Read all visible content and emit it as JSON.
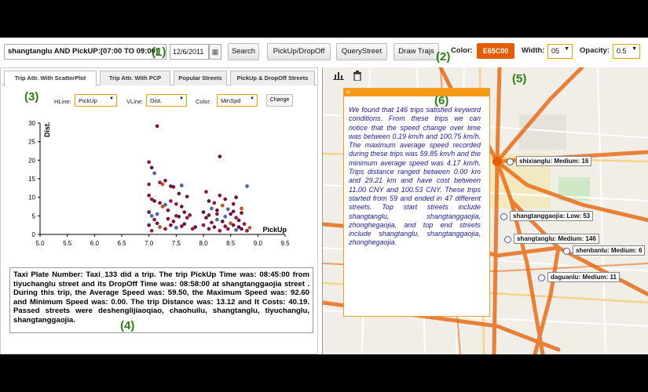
{
  "toolbar": {
    "query_value": "shangtanglu AND PickUP:[07:00 TO 09:00]",
    "date_value": "12/6/2011",
    "calendar_icon": "calendar-icon",
    "search_label": "Search",
    "pickup_dropoff_label": "PickUp/DropOff",
    "query_street_label": "QueryStreet",
    "draw_trajs_label": "Draw Trajs",
    "color_label": "Color:",
    "color_value": "E65C00",
    "color_hex": "#E65C00",
    "width_label": "Width:",
    "width_value": "05",
    "opacity_label": "Opacity:",
    "opacity_value": "0.5"
  },
  "annotations": [
    "(1)",
    "(2)",
    "(3)",
    "(4)",
    "(5)",
    "(6)"
  ],
  "tabs": [
    {
      "label": "Trip Attr. With ScatterPlot",
      "active": true
    },
    {
      "label": "Trip Attr. With PCP",
      "active": false
    },
    {
      "label": "Popular Streets",
      "active": false
    },
    {
      "label": "PickUp & DropOff Streets",
      "active": false
    }
  ],
  "controls": {
    "hline_label": "HLine:",
    "hline_value": "PickUp",
    "vline_label": "VLine:",
    "vline_value": "Dist.",
    "color_label": "Color:",
    "color_value": "MinSpd",
    "change_label": "Change"
  },
  "chart_data": {
    "type": "scatter",
    "xlabel": "PickUp",
    "ylabel": "Dist.",
    "xlim": [
      5.0,
      9.5
    ],
    "ylim": [
      0,
      30
    ],
    "xticks": [
      "5.0",
      "5.5",
      "6.0",
      "6.5",
      "7.0",
      "7.5",
      "8.0",
      "8.5",
      "9.0",
      "9.5"
    ],
    "yticks": [
      "0",
      "5",
      "10",
      "15",
      "20",
      "25",
      "30"
    ],
    "points": [
      [
        7.15,
        29.2
      ],
      [
        7.0,
        19.5
      ],
      [
        7.05,
        18.0
      ],
      [
        7.1,
        16.5
      ],
      [
        7.2,
        14.0
      ],
      [
        7.25,
        13.5
      ],
      [
        7.3,
        14.5
      ],
      [
        7.0,
        13.5
      ],
      [
        7.4,
        13.0
      ],
      [
        7.45,
        12.8
      ],
      [
        7.6,
        13.2
      ],
      [
        7.55,
        11.0
      ],
      [
        7.0,
        10.5
      ],
      [
        7.05,
        9.5
      ],
      [
        7.1,
        9.0
      ],
      [
        7.2,
        8.5
      ],
      [
        7.25,
        7.5
      ],
      [
        7.3,
        8.0
      ],
      [
        7.35,
        6.5
      ],
      [
        7.5,
        8.2
      ],
      [
        7.6,
        7.5
      ],
      [
        7.65,
        6.0
      ],
      [
        7.7,
        4.5
      ],
      [
        7.0,
        6.0
      ],
      [
        7.05,
        5.0
      ],
      [
        7.1,
        4.0
      ],
      [
        7.15,
        3.0
      ],
      [
        7.2,
        2.0
      ],
      [
        7.3,
        1.5
      ],
      [
        7.4,
        2.5
      ],
      [
        7.45,
        3.5
      ],
      [
        7.5,
        1.8
      ],
      [
        7.55,
        4.8
      ],
      [
        7.6,
        2.2
      ],
      [
        7.8,
        1.5
      ],
      [
        7.85,
        2.0
      ],
      [
        7.0,
        2.5
      ],
      [
        7.05,
        1.0
      ],
      [
        7.15,
        5.5
      ],
      [
        7.35,
        4.2
      ],
      [
        7.5,
        5.0
      ],
      [
        7.65,
        2.8
      ],
      [
        7.75,
        5.2
      ],
      [
        8.05,
        11.5
      ],
      [
        8.1,
        9.0
      ],
      [
        8.15,
        7.0
      ],
      [
        8.2,
        8.5
      ],
      [
        8.25,
        6.5
      ],
      [
        8.3,
        10.5
      ],
      [
        8.35,
        7.8
      ],
      [
        8.3,
        21.0
      ],
      [
        8.4,
        9.5
      ],
      [
        8.45,
        6.8
      ],
      [
        8.5,
        5.5
      ],
      [
        8.55,
        8.2
      ],
      [
        8.6,
        4.5
      ],
      [
        8.65,
        3.8
      ],
      [
        8.7,
        5.8
      ],
      [
        8.75,
        2.8
      ],
      [
        8.8,
        13.0
      ],
      [
        8.85,
        1.8
      ],
      [
        8.0,
        2.5
      ],
      [
        8.05,
        4.5
      ],
      [
        8.1,
        1.5
      ],
      [
        8.15,
        3.2
      ],
      [
        8.2,
        2.0
      ],
      [
        8.25,
        4.0
      ],
      [
        8.3,
        1.0
      ],
      [
        8.35,
        3.5
      ],
      [
        8.4,
        2.2
      ],
      [
        8.45,
        1.5
      ],
      [
        8.5,
        3.0
      ],
      [
        8.55,
        2.5
      ],
      [
        8.6,
        1.2
      ],
      [
        8.65,
        2.0
      ],
      [
        8.7,
        1.5
      ],
      [
        8.8,
        1.0
      ],
      [
        8.0,
        6.0
      ],
      [
        8.1,
        5.2
      ],
      [
        8.25,
        5.5
      ],
      [
        8.4,
        4.8
      ],
      [
        8.55,
        6.2
      ],
      [
        8.7,
        7.0
      ],
      [
        8.6,
        10.0
      ],
      [
        7.7,
        10.2
      ],
      [
        7.4,
        9.0
      ]
    ]
  },
  "trip_info": "Taxi Plate Number: Taxi_133 did a trip. The trip PickUp Time was: 08:45:00 from tiyuchanglu street and its DropOff Time was: 08:58:00 at shangtanggaojia street . During this trip, the Average Speed was: 59.50, the Maximum Speed was: 92.60 and Minimum Speed was: 0.00. The trip Distance was: 13.12 and It Costs: 40.19. Passed streets were deshenglijiaoqiao, chaohuilu, shangtanglu, tiyuchanglu, shangtanggaojia.",
  "map": {
    "chart_icon": "bar-chart-icon",
    "trash_icon": "trash-icon",
    "popup_text": "We found that 146 trips satisfied keyword conditions. From these trips we can notice that the speed change over time was between 0.19 km/h and 100.75 km/h. The maximum average speed recorded during these trips was 59.85 km/h and the minimum average speed was 4.17 km/h. Trips distance ranged between 0.00 km and 29.21 km and have cost between 11.00 CNY and 100.53 CNY. These trips started from 59 and ended in 47 different streets. Top start streets include shangtanglu, shangtanggaojia, zhonghegaojia, and top end streets include shangtanglu, shangtanggaojia, zhonghegaojia.",
    "streets": [
      {
        "label": "shixianglu: Medium: 16"
      },
      {
        "label": "shangtanggaojia: Low: 53"
      },
      {
        "label": "shangtanglu: Medium: 146"
      },
      {
        "label": "shenbanlu: Medium: 6"
      },
      {
        "label": "daguanlu: Medium: 11"
      }
    ]
  }
}
